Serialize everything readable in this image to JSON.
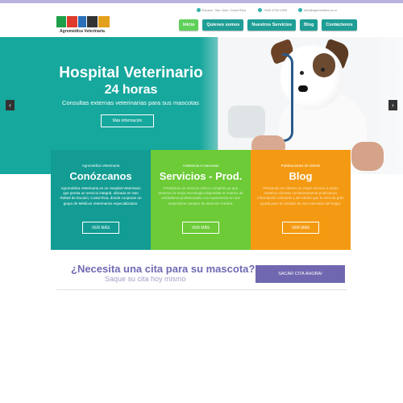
{
  "header": {
    "logo_text": "Agromédica Veterinaria",
    "contact": {
      "address": "Escazú, San José, Costa Rica",
      "phone": "+506 4700-1590",
      "email": "info@agromedica.co.cr"
    },
    "nav": [
      {
        "label": "Inicio",
        "active": true
      },
      {
        "label": "Quienes somos",
        "active": false
      },
      {
        "label": "Nuestros Servicios",
        "active": false
      },
      {
        "label": "Blog",
        "active": false
      },
      {
        "label": "Contáctenos",
        "active": false
      }
    ]
  },
  "hero": {
    "title_line1": "Hospital Veterinario",
    "title_line2": "24 horas",
    "subtitle": "Consultas externas veterinarias para sus mascotas",
    "button_label": "Más información",
    "prev_glyph": "‹",
    "next_glyph": "›"
  },
  "panels": [
    {
      "kicker": "Agromédica Veterinaria",
      "title": "Conózcanos",
      "body": "Agromédica Veterinaria es un Hospital Veterinario que presta un servicio integral, ubicado en San Rafael de Escazú, Costa Rica, donde cooperan un grupo de Médicos Veterinarios especializados.",
      "button": "VER MÁS"
    },
    {
      "kicker": "Asistencia a mascotas",
      "title": "Servicios - Prod.",
      "body": "Prestamos un servicio clínico completo ya que tenemos la mejor tecnología disponible en manos de verdaderos profesionales con experiencia en sus respectivos campos de atención médica.",
      "button": "VER MÁS"
    },
    {
      "kicker": "Publicaciones de interés",
      "title": "Blog",
      "body": "Pensando en ofrecer un mejor servicio a todos nuestros clientes constantemente publicamos información relevante y de interés que le será de gran ayuda para el cuidado de sus mascotas del hogar.",
      "button": "VER MÁS"
    }
  ],
  "cta": {
    "title": "¿Necesita una cita para su mascota?",
    "subtitle": "Saque su cita hoy mismo",
    "button": "SACAR CITA AHORA!"
  },
  "colors": {
    "teal": "#16a79d",
    "green": "#6ccb36",
    "orange": "#f49a12",
    "purple": "#6f68b0"
  }
}
